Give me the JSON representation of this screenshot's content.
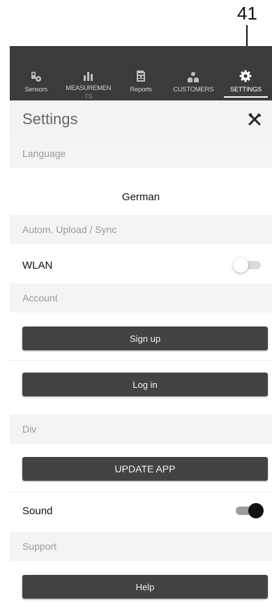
{
  "callout": {
    "number": "41"
  },
  "tabs": [
    {
      "label": "Sensors",
      "label2": "",
      "icon": "sensor-icon",
      "active": false
    },
    {
      "label": "MEASUREMEN",
      "label2": "TS",
      "icon": "bar-chart-icon",
      "active": false
    },
    {
      "label": "Reports",
      "label2": "",
      "icon": "report-icon",
      "active": false
    },
    {
      "label": "CUSTOMERS",
      "label2": "",
      "icon": "customers-icon",
      "active": false
    },
    {
      "label": "SETTINGS",
      "label2": "",
      "icon": "gear-icon",
      "active": true
    }
  ],
  "header": {
    "title": "Settings",
    "tools_icon": "tools-icon"
  },
  "language": {
    "section": "Language",
    "value": "German"
  },
  "sync": {
    "section": "Autom. Upload / Sync",
    "wlan_label": "WLAN",
    "wlan_on": false
  },
  "account": {
    "section": "Account",
    "signup": "Sign up",
    "login": "Log in"
  },
  "div": {
    "section": "Div",
    "update": "UPDATE APP",
    "sound_label": "Sound",
    "sound_on": true
  },
  "support": {
    "section": "Support",
    "help": "Help"
  },
  "colors": {
    "tabbar": "#3b3b3b",
    "button": "#434343",
    "section_bg": "#f4f4f4"
  }
}
